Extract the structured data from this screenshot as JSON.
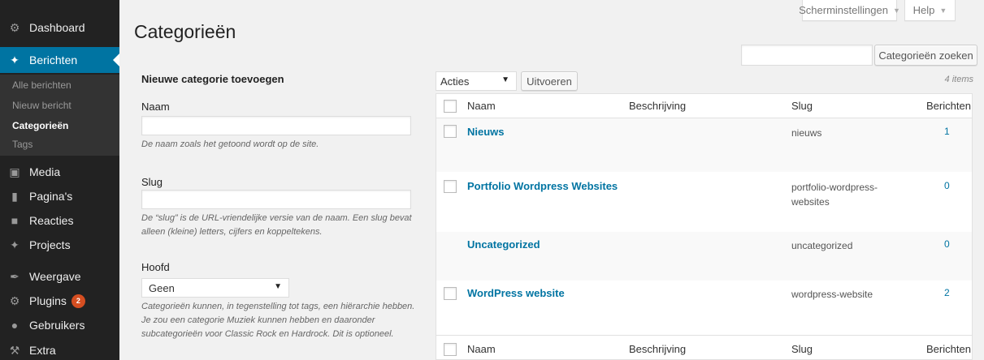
{
  "sidebar": {
    "dashboard": "Dashboard",
    "berichten": "Berichten",
    "submenu": [
      "Alle berichten",
      "Nieuw bericht",
      "Categorieën",
      "Tags"
    ],
    "media": "Media",
    "paginas": "Pagina's",
    "reacties": "Reacties",
    "projects": "Projects",
    "weergave": "Weergave",
    "plugins": "Plugins",
    "plugins_badge": "2",
    "gebruikers": "Gebruikers",
    "extra": "Extra"
  },
  "header": {
    "screen_options": "Scherminstellingen",
    "help": "Help",
    "title": "Categorieën",
    "search_button": "Categorieën zoeken"
  },
  "form": {
    "heading": "Nieuwe categorie toevoegen",
    "name_label": "Naam",
    "name_desc": "De naam zoals het getoond wordt op de site.",
    "slug_label": "Slug",
    "slug_desc": "De “slug” is de URL-vriendelijke versie van de naam. Een slug bevat alleen (kleine) letters, cijfers en koppeltekens.",
    "parent_label": "Hoofd",
    "parent_value": "Geen",
    "parent_desc": "Categorieën kunnen, in tegenstelling tot tags, een hiërarchie hebben. Je zou een categorie Muziek kunnen hebben en daaronder subcategorieën voor Classic Rock en Hardrock. Dit is optioneel."
  },
  "bulk": {
    "action_value": "Acties",
    "apply_button": "Uitvoeren",
    "items_count": "4 items"
  },
  "table": {
    "columns": [
      "Naam",
      "Beschrijving",
      "Slug",
      "Berichten"
    ],
    "rows": [
      {
        "name": "Nieuws",
        "slug": "nieuws",
        "count": "1"
      },
      {
        "name": "Portfolio Wordpress Websites",
        "slug": "portfolio-wordpress-websites",
        "count": "0"
      },
      {
        "name": "Uncategorized",
        "slug": "uncategorized",
        "count": "0"
      },
      {
        "name": "WordPress website",
        "slug": "wordpress-website",
        "count": "2"
      }
    ]
  },
  "colors": {
    "sidebar_bg": "#222222",
    "active_menu": "#0074a2",
    "link": "#0074a2",
    "badge": "#d54e21"
  }
}
